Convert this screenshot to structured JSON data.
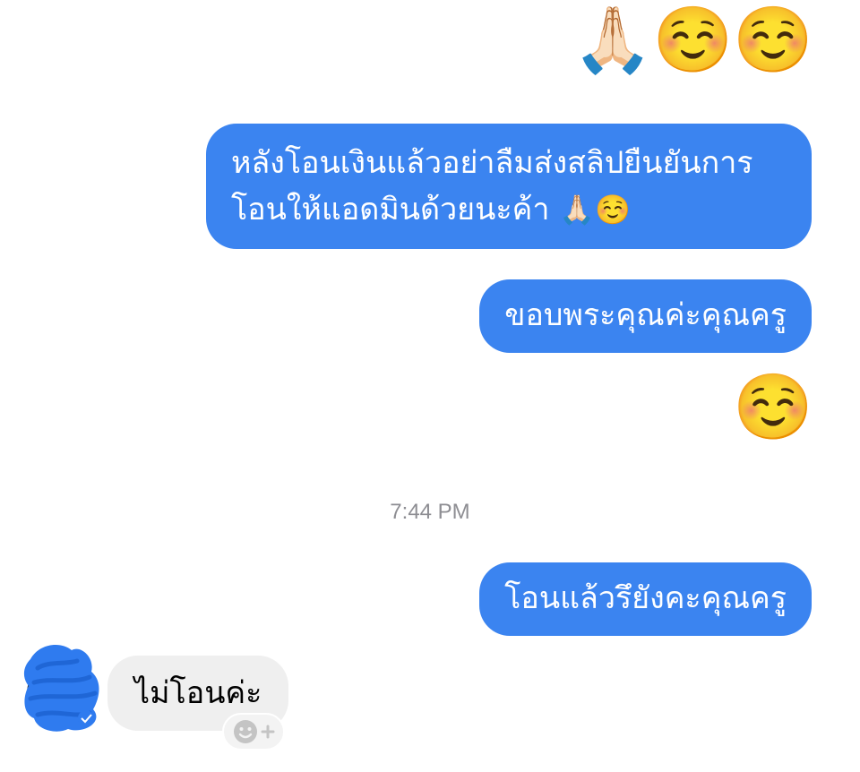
{
  "chat": {
    "emoji_top": [
      "🙏🏻",
      "☺️",
      "☺️"
    ],
    "msg1": {
      "line1": "หลังโอนเงินแล้วอย่าลืมส่งสลิปยืนยันการ",
      "line2": "โอนให้แอดมินด้วยนะค้า",
      "emojis": "🙏🏻☺️"
    },
    "msg2": "ขอบพระคุณค่ะคุณครู",
    "emoji_single": "☺️",
    "timestamp": "7:44 PM",
    "msg3": "โอนแล้วรึยังคะคุณครู",
    "reply": "ไม่โอนค่ะ"
  },
  "colors": {
    "outgoing_bubble": "#3b84f0",
    "incoming_bubble": "#efefef",
    "timestamp_text": "#8e8e93"
  },
  "icons": {
    "reaction": "add-reaction-icon",
    "avatar": "avatar-redacted"
  }
}
